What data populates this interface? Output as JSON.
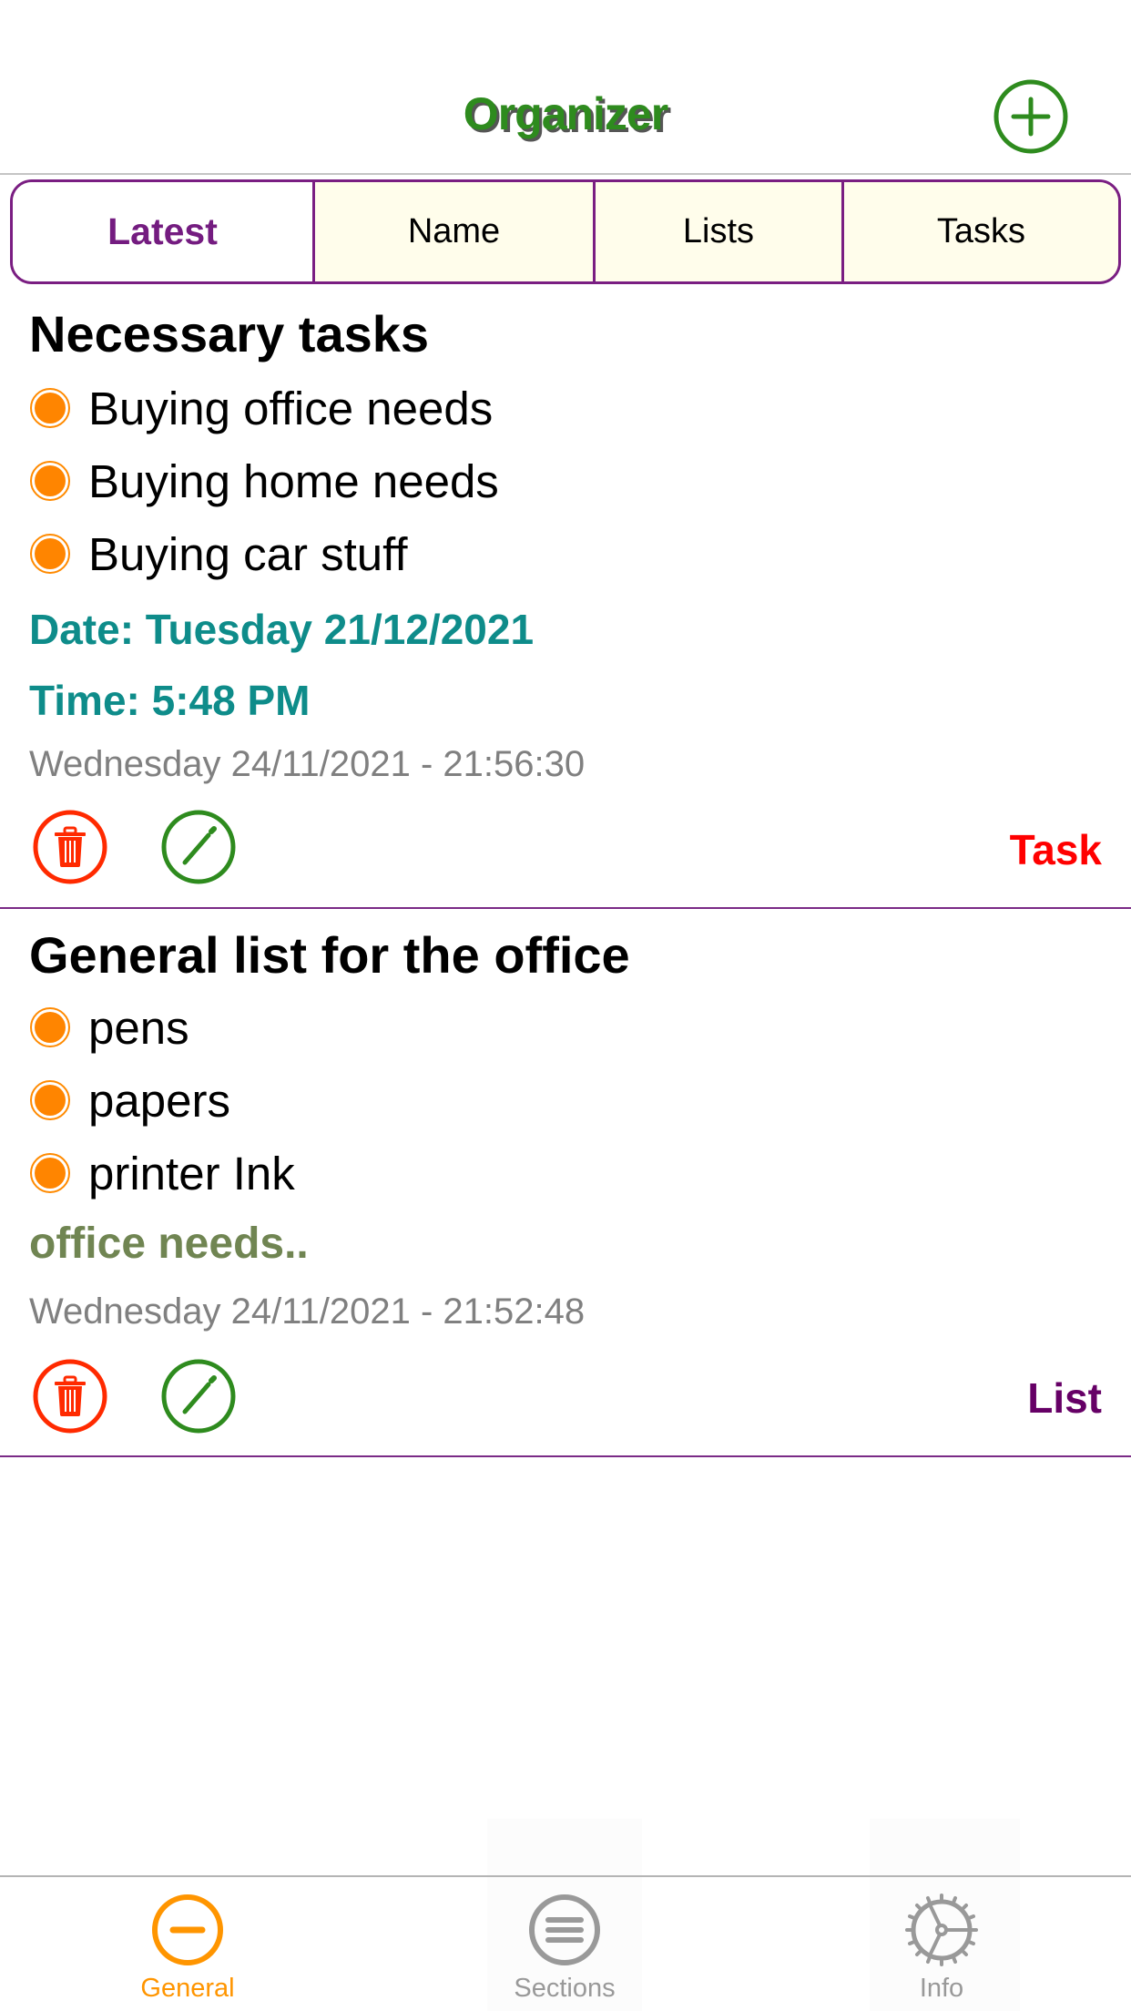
{
  "header": {
    "title": "Organizer",
    "add_icon": "plus-circle-icon"
  },
  "segments": [
    {
      "label": "Latest",
      "selected": true
    },
    {
      "label": "Name",
      "selected": false
    },
    {
      "label": "Lists",
      "selected": false
    },
    {
      "label": "Tasks",
      "selected": false
    }
  ],
  "cards": [
    {
      "title": "Necessary tasks",
      "items": [
        "Buying office needs",
        "Buying home needs",
        "Buying car stuff"
      ],
      "date": "Date: Tuesday 21/12/2021",
      "time": "Time: 5:48 PM",
      "timestamp": "Wednesday 24/11/2021 - 21:56:30",
      "type": "Task",
      "type_color": "#FF0000",
      "delete_icon": "trash-icon",
      "edit_icon": "pencil-icon"
    },
    {
      "title": "General list for the office",
      "items": [
        "pens",
        "papers",
        "printer Ink"
      ],
      "note": "office needs..",
      "timestamp": "Wednesday 24/11/2021 - 21:52:48",
      "type": "List",
      "type_color": "#660066",
      "delete_icon": "trash-icon",
      "edit_icon": "pencil-icon"
    }
  ],
  "tabbar": [
    {
      "label": "General",
      "icon": "minus-circle-icon",
      "active": true
    },
    {
      "label": "Sections",
      "icon": "list-circle-icon",
      "active": false
    },
    {
      "label": "Info",
      "icon": "gear-icon",
      "active": false
    }
  ],
  "colors": {
    "accent_green": "#2E8B1E",
    "accent_purple": "#7A1E82",
    "bullet_orange": "#FF8500",
    "delete_red": "#FF2A00",
    "teal": "#0E8C8A",
    "tab_active": "#FF9500",
    "tab_inactive": "#999999"
  }
}
